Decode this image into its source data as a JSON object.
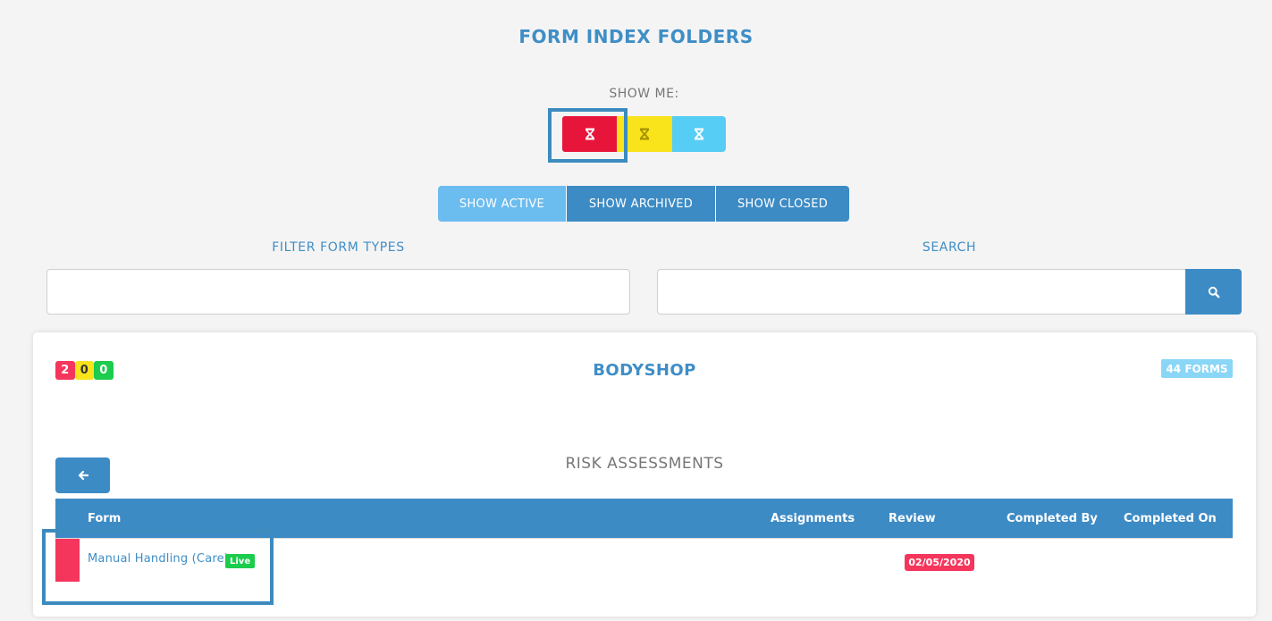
{
  "page": {
    "title": "FORM INDEX FOLDERS"
  },
  "filters": {
    "show_me_label": "SHOW ME:",
    "status_buttons": [
      {
        "name": "red",
        "icon": "hourglass-icon",
        "color": "#e8153b"
      },
      {
        "name": "yellow",
        "icon": "hourglass-icon",
        "color": "#f9e31b"
      },
      {
        "name": "blue",
        "icon": "hourglass-icon",
        "color": "#56cdf5"
      }
    ],
    "view_tabs": {
      "active": "SHOW ACTIVE",
      "archived": "SHOW ARCHIVED",
      "closed": "SHOW CLOSED"
    },
    "form_type_label": "FILTER FORM TYPES",
    "form_type_value": "",
    "search_label": "SEARCH",
    "search_value": ""
  },
  "folder": {
    "counts": {
      "red": "2",
      "yellow": "0",
      "green": "0"
    },
    "name": "BODYSHOP",
    "forms_badge": "44 FORMS"
  },
  "section": {
    "title": "RISK ASSESSMENTS",
    "table": {
      "headers": {
        "form": "Form",
        "assignments": "Assignments",
        "review": "Review",
        "completed_by": "Completed By",
        "completed_on": "Completed On"
      },
      "rows": [
        {
          "status_color": "#f5365c",
          "form": "Manual Handling (Care)",
          "badge": "Live",
          "assignments": "",
          "review": "02/05/2020",
          "completed_by": "",
          "completed_on": ""
        }
      ]
    }
  },
  "colors": {
    "accent": "#3d8bc5",
    "accent_light": "#6bbcef",
    "title": "#3f8ec6",
    "red": "#f5365c",
    "green": "#1bcc4d",
    "yellow": "#f9e31b"
  }
}
